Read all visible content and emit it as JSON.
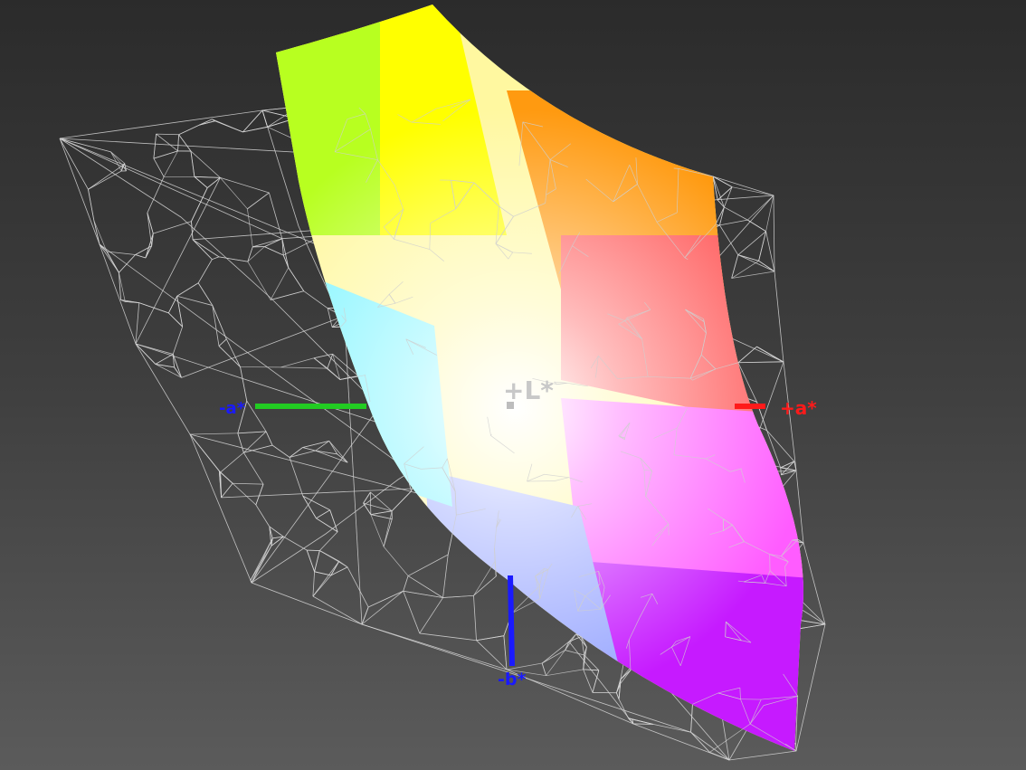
{
  "viewer": {
    "background_top": "#2b2b2b",
    "background_bottom": "#5b5b5b",
    "wireframe_color": "#d8d8d8"
  },
  "axes": {
    "plus_l": {
      "label": "+L*",
      "color": "#c8c8c8"
    },
    "plus_a": {
      "label": "+a*",
      "color": "#ff1a1a"
    },
    "minus_a": {
      "label": "-a*",
      "color": "#1a1aff",
      "line_color": "#22cc22"
    },
    "minus_b": {
      "label": "-b*",
      "color": "#1a1aff"
    }
  },
  "gamut_colors": {
    "yellow": "#ffff00",
    "green_yellow": "#b8ff20",
    "orange": "#ff7a00",
    "red": "#ff4a4a",
    "magenta": "#ff33ff",
    "violet": "#c61aff",
    "blue": "#9aa8ff",
    "cyan": "#7ff5ff",
    "white": "#ffffff"
  }
}
